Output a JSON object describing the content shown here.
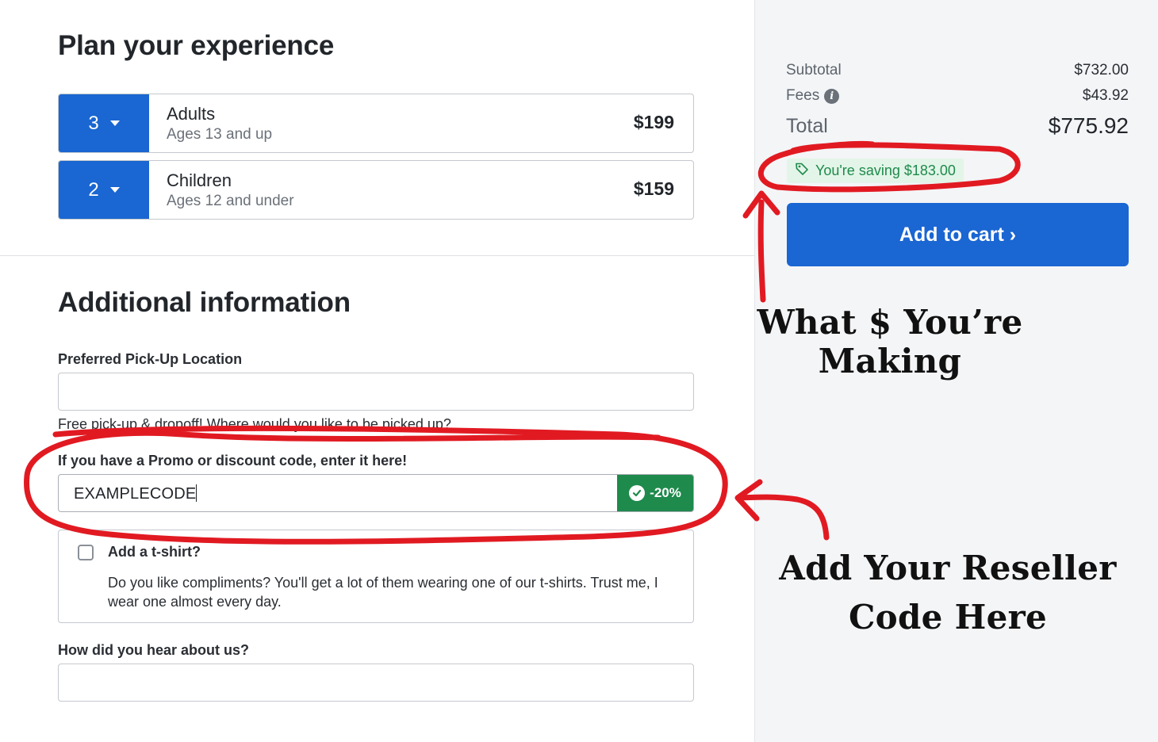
{
  "plan": {
    "title": "Plan your experience",
    "tickets": [
      {
        "qty": "3",
        "name": "Adults",
        "sub": "Ages 13 and up",
        "price": "$199"
      },
      {
        "qty": "2",
        "name": "Children",
        "sub": "Ages 12 and under",
        "price": "$159"
      }
    ]
  },
  "additional": {
    "title": "Additional information",
    "pickup_label": "Preferred Pick-Up Location",
    "pickup_value": "",
    "pickup_help": "Free pick-up & dropoff! Where would you like to be picked up?",
    "promo_label": "If you have a Promo or discount code, enter it here!",
    "promo_value": "EXAMPLECODE",
    "promo_badge": "-20%",
    "tshirt_title": "Add a t-shirt?",
    "tshirt_desc": "Do you like compliments? You'll get a lot of them wearing one of our t-shirts. Trust me, I wear one almost every day.",
    "hear_label": "How did you hear about us?",
    "hear_value": ""
  },
  "summary": {
    "subtotal_label": "Subtotal",
    "subtotal_value": "$732.00",
    "fees_label": "Fees",
    "fees_value": "$43.92",
    "total_label": "Total",
    "total_value": "$775.92",
    "saving_text": "You're saving $183.00",
    "cart_button": "Add to cart ›"
  },
  "annotations": {
    "making": "What $ You’re Making",
    "reseller_line1": "Add Your Reseller",
    "reseller_line2": "Code Here"
  },
  "colors": {
    "primary": "#1a66d2",
    "success": "#1e8a4c",
    "annotation_red": "#e11a22"
  },
  "icons": [
    "chevron-down-icon",
    "info-icon",
    "tag-icon",
    "check-circle-icon"
  ]
}
